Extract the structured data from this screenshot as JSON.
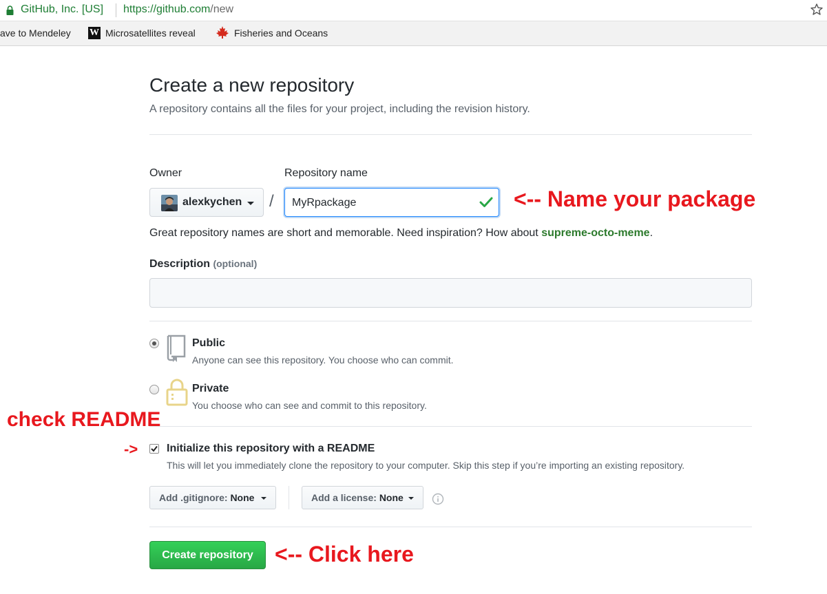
{
  "browser": {
    "site_identity": "GitHub, Inc. [US]",
    "url_host": "https://github.com",
    "url_path": "/new",
    "bookmarks": [
      {
        "label": "ave to Mendeley"
      },
      {
        "label": "Microsatellites reveal"
      },
      {
        "label": "Fisheries and Oceans"
      }
    ],
    "bookmark_w_glyph": "W"
  },
  "page": {
    "title": "Create a new repository",
    "subtitle": "A repository contains all the files for your project, including the revision history."
  },
  "form": {
    "owner_label": "Owner",
    "owner_value": "alexkychen",
    "slash": "/",
    "repo_label": "Repository name",
    "repo_value": "MyRpackage",
    "hint_prefix": "Great repository names are short and memorable. Need inspiration? How about ",
    "hint_suggestion": "supreme-octo-meme",
    "hint_suffix": ".",
    "description_label": "Description",
    "description_optional": "(optional)",
    "description_value": "",
    "visibility": [
      {
        "title": "Public",
        "desc": "Anyone can see this repository. You choose who can commit.",
        "selected": true
      },
      {
        "title": "Private",
        "desc": "You choose who can see and commit to this repository.",
        "selected": false
      }
    ],
    "readme_label": "Initialize this repository with a README",
    "readme_desc": "This will let you immediately clone the repository to your computer. Skip this step if you’re importing an existing repository.",
    "readme_checked": true,
    "gitignore_label": "Add .gitignore:",
    "gitignore_value": "None",
    "license_label": "Add a license:",
    "license_value": "None",
    "submit_label": "Create repository"
  },
  "annotations": {
    "name_package": "<-- Name your package",
    "check_readme": "check README",
    "readme_arrow": "->",
    "click_here": "<-- Click here"
  },
  "colors": {
    "accent_green": "#28a745",
    "annotation_red": "#e8181e",
    "focus_blue": "#2188ff"
  },
  "icons": [
    "lock-icon",
    "star-icon",
    "maple-leaf-icon",
    "check-icon",
    "book-icon",
    "lock-padlock-icon",
    "info-icon",
    "caret-down-icon"
  ]
}
